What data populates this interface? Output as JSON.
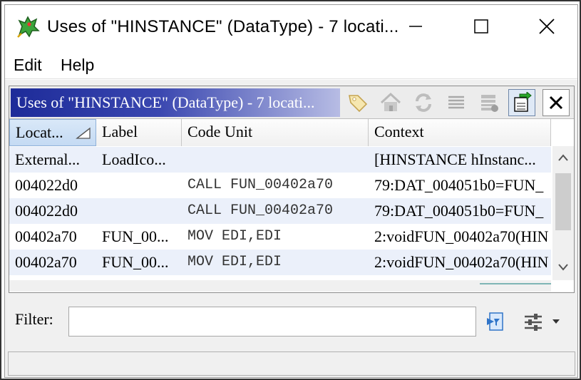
{
  "window": {
    "title": "Uses of \"HINSTANCE\" (DataType) - 7 locati..."
  },
  "menu": {
    "items": [
      "Edit",
      "Help"
    ]
  },
  "panel": {
    "title": "Uses of \"HINSTANCE\" (DataType) - 7 locati...",
    "toolbar_icons": [
      "tag-icon",
      "home-icon",
      "refresh-icon",
      "list-icon",
      "table-export-icon",
      "go-to-icon",
      "close-icon"
    ]
  },
  "table": {
    "columns": [
      "Locat...",
      "Label",
      "Code Unit",
      "Context"
    ],
    "rows": [
      {
        "location": "External...",
        "label": "LoadIco...",
        "code_unit": "",
        "context": "[HINSTANCE hInstanc..."
      },
      {
        "location": "004022d0",
        "label": "",
        "code_unit": "CALL FUN_00402a70",
        "context": "79:DAT_004051b0=FUN_"
      },
      {
        "location": "004022d0",
        "label": "",
        "code_unit": "CALL FUN_00402a70",
        "context": "79:DAT_004051b0=FUN_"
      },
      {
        "location": "00402a70",
        "label": "FUN_00...",
        "code_unit": "MOV EDI,EDI",
        "context": "2:voidFUN_00402a70(HIN"
      },
      {
        "location": "00402a70",
        "label": "FUN_00...",
        "code_unit": "MOV EDI,EDI",
        "context": "2:voidFUN_00402a70(HIN"
      }
    ]
  },
  "filter": {
    "label": "Filter:",
    "value": ""
  },
  "colors": {
    "title_gradient_start": "#1d2b99",
    "row_alt": "#ebf0fa",
    "sorted_header": "#c4daf3"
  }
}
